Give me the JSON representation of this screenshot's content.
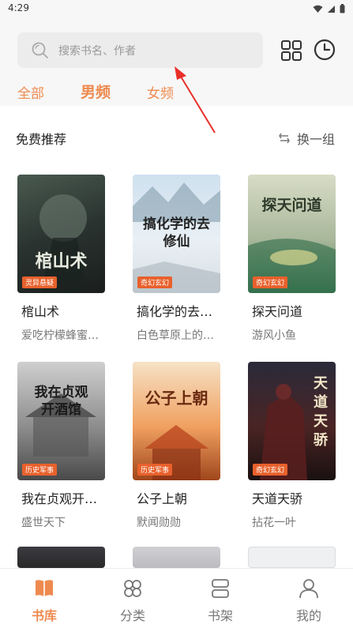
{
  "status": {
    "time": "4:29"
  },
  "search": {
    "placeholder": "搜索书名、作者"
  },
  "tabs": [
    {
      "label": "全部"
    },
    {
      "label": "男频"
    },
    {
      "label": "女频"
    }
  ],
  "section": {
    "title": "免费推荐",
    "refresh_label": "换一组"
  },
  "books": [
    {
      "title": "棺山术",
      "author": "爱吃柠檬蜂蜜…",
      "cover_title": "棺山术",
      "badge": "灵异悬疑"
    },
    {
      "title": "搞化学的去…",
      "author": "白色草原上的…",
      "cover_title": "搞化学的去修仙",
      "badge": "奇幻玄幻"
    },
    {
      "title": "探天问道",
      "author": "游风小鱼",
      "cover_title": "探天问道",
      "badge": "奇幻玄幻"
    },
    {
      "title": "我在贞观开…",
      "author": "盛世天下",
      "cover_title": "我在贞观开酒馆",
      "badge": "历史军事"
    },
    {
      "title": "公子上朝",
      "author": "默闻勋勋",
      "cover_title": "公子上朝",
      "badge": "历史军事"
    },
    {
      "title": "天道天骄",
      "author": "拈花一叶",
      "cover_title": "天道天骄",
      "badge": "奇幻玄幻"
    }
  ],
  "bottom_nav": [
    {
      "label": "书库",
      "icon": "book-icon"
    },
    {
      "label": "分类",
      "icon": "category-icon"
    },
    {
      "label": "书架",
      "icon": "shelf-icon"
    },
    {
      "label": "我的",
      "icon": "user-icon"
    }
  ],
  "colors": {
    "accent": "#ee8a4f",
    "arrow": "#e8302a"
  }
}
